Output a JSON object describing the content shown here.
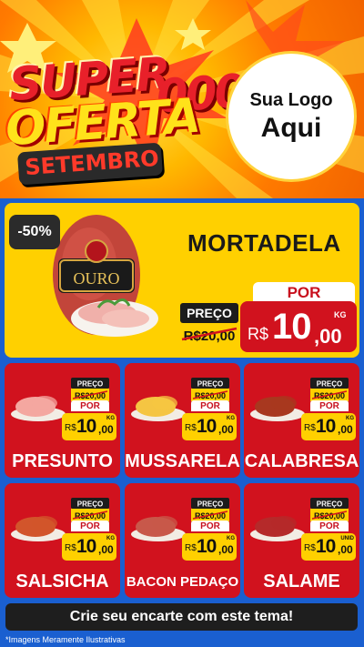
{
  "header": {
    "title_line1": "SUPER",
    "title_line2": "OFERTA",
    "title_deco": "000",
    "month": "SETEMBRO",
    "logo_line1": "Sua Logo",
    "logo_line2": "Aqui"
  },
  "hero": {
    "discount": "-50%",
    "product": "MORTADELA",
    "preco_label": "PREÇO",
    "old_price": "R$20,00",
    "por_label": "POR",
    "currency": "R$",
    "price_int": "10",
    "price_dec": ",00",
    "unit": "KG",
    "brand_text": "OURO"
  },
  "products": [
    {
      "name": "PRESUNTO",
      "preco_label": "PREÇO",
      "old_price": "R$20,00",
      "por_label": "POR",
      "currency": "R$",
      "price_int": "10",
      "price_dec": ",00",
      "unit": "KG",
      "color": "#f4a7a0"
    },
    {
      "name": "MUSSARELA",
      "preco_label": "PREÇO",
      "old_price": "R$20,00",
      "por_label": "POR",
      "currency": "R$",
      "price_int": "10",
      "price_dec": ",00",
      "unit": "KG",
      "color": "#f5c542"
    },
    {
      "name": "CALABRESA",
      "preco_label": "PREÇO",
      "old_price": "R$20,00",
      "por_label": "POR",
      "currency": "R$",
      "price_int": "10",
      "price_dec": ",00",
      "unit": "KG",
      "color": "#a8381f"
    },
    {
      "name": "SALSICHA",
      "preco_label": "PREÇO",
      "old_price": "R$20,00",
      "por_label": "POR",
      "currency": "R$",
      "price_int": "10",
      "price_dec": ",00",
      "unit": "KG",
      "color": "#d2552b"
    },
    {
      "name": "BACON PEDAÇO",
      "preco_label": "PREÇO",
      "old_price": "R$20,00",
      "por_label": "POR",
      "currency": "R$",
      "price_int": "10",
      "price_dec": ",00",
      "unit": "KG",
      "color": "#c8584a"
    },
    {
      "name": "SALAME",
      "preco_label": "PREÇO",
      "old_price": "R$20,00",
      "por_label": "POR",
      "currency": "R$",
      "price_int": "10",
      "price_dec": ",00",
      "unit": "UNID",
      "color": "#b52a2a"
    }
  ],
  "footer": {
    "cta": "Crie seu encarte com este tema!",
    "disclaimer": "*Imagens Meramente Ilustrativas"
  },
  "colors": {
    "background_blue": "#1a5fd0",
    "card_red": "#d1121e",
    "accent_yellow": "#ffd000",
    "dark": "#1e1e1e"
  }
}
